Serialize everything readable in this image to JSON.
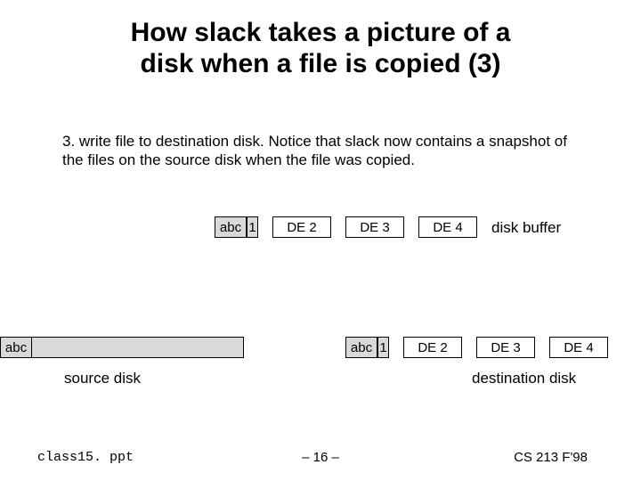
{
  "title_line1": "How slack takes a picture of a",
  "title_line2": "disk when a file is copied (3)",
  "body": "3. write file to destination disk. Notice that slack now contains a snapshot of the files on the source disk when the file was copied.",
  "disk_buffer": {
    "cells": {
      "abc": "abc",
      "r1": "1",
      "de2": "DE 2",
      "de3": "DE 3",
      "de4": "DE 4"
    },
    "label": "disk buffer"
  },
  "source_disk": {
    "abc": "abc",
    "label": "source disk"
  },
  "destination_disk": {
    "cells": {
      "abc": "abc",
      "r1": "1",
      "de2": "DE 2",
      "de3": "DE 3",
      "de4": "DE 4"
    },
    "label": "destination disk"
  },
  "footer": {
    "left": "class15. ppt",
    "center": "– 16 –",
    "right": "CS 213 F'98"
  }
}
